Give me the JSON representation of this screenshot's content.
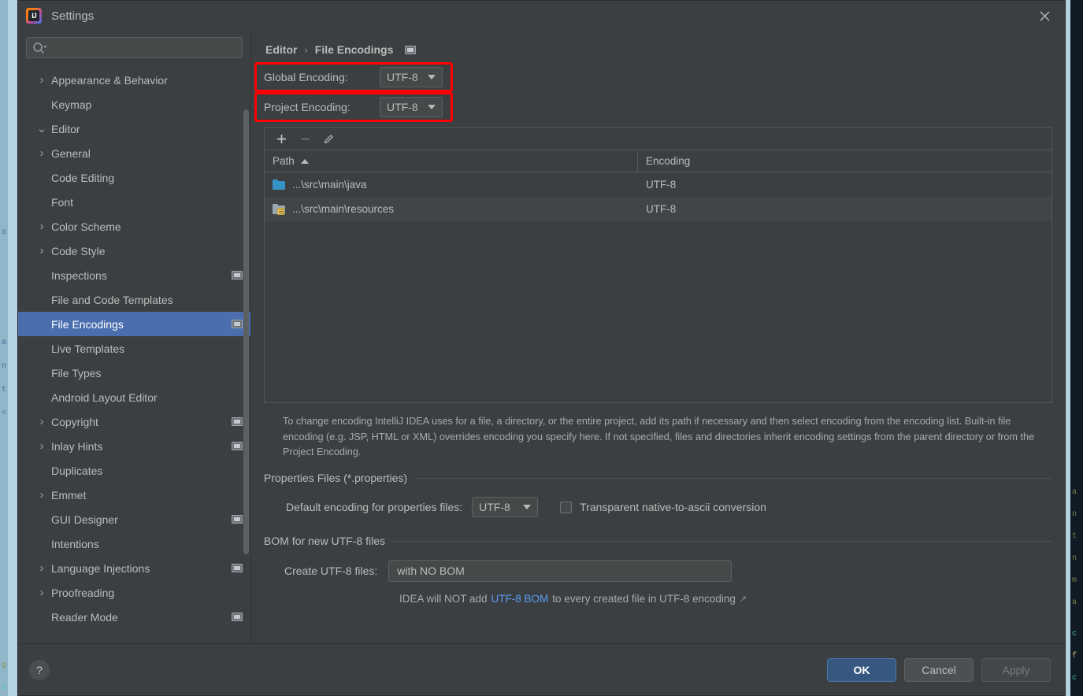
{
  "window": {
    "title": "Settings",
    "app_icon": "intellij-idea-icon",
    "close_label": "✕"
  },
  "search": {
    "value": "",
    "placeholder": "",
    "icon": "search-icon"
  },
  "sidebar": {
    "items": [
      {
        "label": "Appearance & Behavior",
        "depth": 1,
        "arrow": "collapsed",
        "badge": false,
        "selected": false
      },
      {
        "label": "Keymap",
        "depth": 1,
        "arrow": "none",
        "badge": false,
        "selected": false
      },
      {
        "label": "Editor",
        "depth": 1,
        "arrow": "expanded",
        "badge": false,
        "selected": false
      },
      {
        "label": "General",
        "depth": 2,
        "arrow": "collapsed",
        "badge": false,
        "selected": false
      },
      {
        "label": "Code Editing",
        "depth": 2,
        "arrow": "none",
        "badge": false,
        "selected": false
      },
      {
        "label": "Font",
        "depth": 2,
        "arrow": "none",
        "badge": false,
        "selected": false
      },
      {
        "label": "Color Scheme",
        "depth": 2,
        "arrow": "collapsed",
        "badge": false,
        "selected": false
      },
      {
        "label": "Code Style",
        "depth": 2,
        "arrow": "collapsed",
        "badge": false,
        "selected": false
      },
      {
        "label": "Inspections",
        "depth": 2,
        "arrow": "none",
        "badge": true,
        "selected": false
      },
      {
        "label": "File and Code Templates",
        "depth": 2,
        "arrow": "none",
        "badge": false,
        "selected": false
      },
      {
        "label": "File Encodings",
        "depth": 2,
        "arrow": "none",
        "badge": true,
        "selected": true
      },
      {
        "label": "Live Templates",
        "depth": 2,
        "arrow": "none",
        "badge": false,
        "selected": false
      },
      {
        "label": "File Types",
        "depth": 2,
        "arrow": "none",
        "badge": false,
        "selected": false
      },
      {
        "label": "Android Layout Editor",
        "depth": 2,
        "arrow": "none",
        "badge": false,
        "selected": false
      },
      {
        "label": "Copyright",
        "depth": 2,
        "arrow": "collapsed",
        "badge": true,
        "selected": false
      },
      {
        "label": "Inlay Hints",
        "depth": 2,
        "arrow": "collapsed",
        "badge": true,
        "selected": false
      },
      {
        "label": "Duplicates",
        "depth": 2,
        "arrow": "none",
        "badge": false,
        "selected": false
      },
      {
        "label": "Emmet",
        "depth": 2,
        "arrow": "collapsed",
        "badge": false,
        "selected": false
      },
      {
        "label": "GUI Designer",
        "depth": 2,
        "arrow": "none",
        "badge": true,
        "selected": false
      },
      {
        "label": "Intentions",
        "depth": 2,
        "arrow": "none",
        "badge": false,
        "selected": false
      },
      {
        "label": "Language Injections",
        "depth": 2,
        "arrow": "collapsed",
        "badge": true,
        "selected": false
      },
      {
        "label": "Proofreading",
        "depth": 2,
        "arrow": "collapsed",
        "badge": false,
        "selected": false
      },
      {
        "label": "Reader Mode",
        "depth": 2,
        "arrow": "none",
        "badge": true,
        "selected": false
      }
    ]
  },
  "main": {
    "breadcrumb": {
      "parent": "Editor",
      "separator": "›",
      "current": "File Encodings",
      "badge_icon": "project-scope-icon"
    },
    "global_encoding": {
      "label": "Global Encoding:",
      "value": "UTF-8",
      "annotated": true
    },
    "project_encoding": {
      "label": "Project Encoding:",
      "value": "UTF-8",
      "annotated": true
    },
    "table_toolbar": {
      "add_label": "+",
      "remove_label": "−",
      "edit_label": "edit-pencil-icon"
    },
    "table": {
      "columns": [
        "Path",
        "Encoding"
      ],
      "sort_column": "Path",
      "sort_direction": "ascending",
      "rows": [
        {
          "icon": "folder-source-icon",
          "path": "...\\src\\main\\java",
          "encoding": "UTF-8"
        },
        {
          "icon": "folder-resource-icon",
          "path": "...\\src\\main\\resources",
          "encoding": "UTF-8"
        }
      ]
    },
    "help_text": "To change encoding IntelliJ IDEA uses for a file, a directory, or the entire project, add its path if necessary and then select encoding from the encoding list. Built-in file encoding (e.g. JSP, HTML or XML) overrides encoding you specify here. If not specified, files and directories inherit encoding settings from the parent directory or from the Project Encoding.",
    "properties_section": {
      "title": "Properties Files (*.properties)",
      "default_encoding_label": "Default encoding for properties files:",
      "default_encoding_value": "UTF-8",
      "transparent_label": "Transparent native-to-ascii conversion",
      "transparent_checked": false
    },
    "bom_section": {
      "title": "BOM for new UTF-8 files",
      "create_label": "Create UTF-8 files:",
      "create_value": "with NO BOM",
      "hint_prefix": "IDEA will NOT add",
      "hint_link": "UTF-8 BOM",
      "hint_suffix": "to every created file in UTF-8 encoding",
      "hint_external_icon": "↗"
    }
  },
  "footer": {
    "help_label": "?",
    "ok_label": "OK",
    "cancel_label": "Cancel",
    "apply_label": "Apply",
    "apply_enabled": false
  },
  "colors": {
    "accent": "#4b6eaf",
    "annotation": "#fe0000",
    "link": "#589df6",
    "panel_bg": "#3c3f41",
    "primary_button": "#365880"
  }
}
